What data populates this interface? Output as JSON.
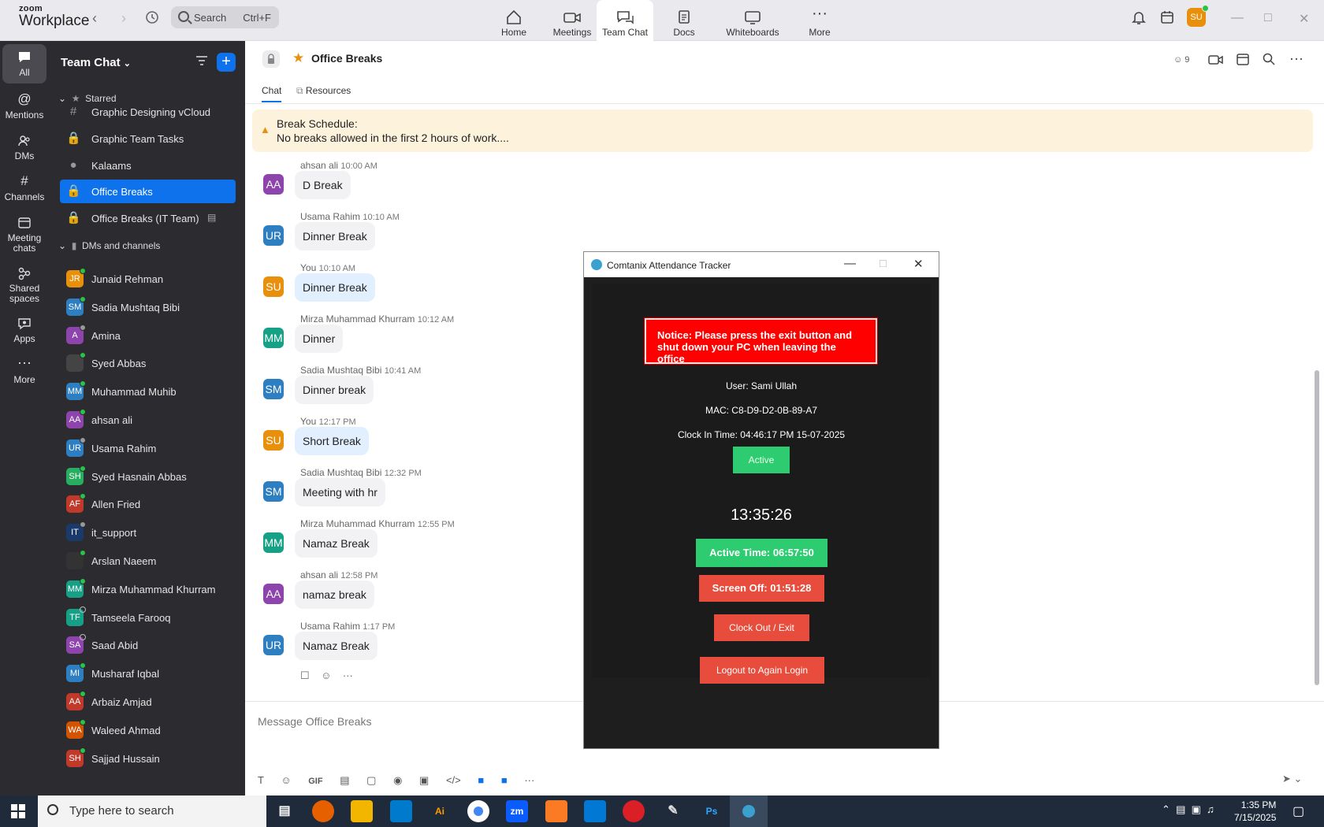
{
  "app": {
    "brand_small": "zoom",
    "brand_big": "Workplace",
    "search_label": "Search",
    "search_shortcut": "Ctrl+F",
    "nav_tabs": [
      {
        "label": "Home"
      },
      {
        "label": "Meetings"
      },
      {
        "label": "Team Chat"
      },
      {
        "label": "Docs"
      },
      {
        "label": "Whiteboards"
      },
      {
        "label": "More"
      }
    ],
    "user_initials": "SU"
  },
  "rail": [
    {
      "label": "All"
    },
    {
      "label": "Mentions"
    },
    {
      "label": "DMs"
    },
    {
      "label": "Channels"
    },
    {
      "label": "Meeting chats"
    },
    {
      "label": "Shared spaces"
    },
    {
      "label": "Apps"
    },
    {
      "label": "More"
    }
  ],
  "sidebar": {
    "title": "Team Chat",
    "starred_label": "Starred",
    "channels": [
      {
        "label": "Graphic Designing vCloud",
        "icon": "hash"
      },
      {
        "label": "Graphic Team Tasks",
        "icon": "lock"
      },
      {
        "label": "Kalaams",
        "icon": "group"
      },
      {
        "label": "Office Breaks",
        "icon": "lock"
      },
      {
        "label": "Office Breaks (IT Team)",
        "icon": "lock"
      }
    ],
    "dm_section_label": "DMs and channels",
    "dms": [
      {
        "name": "Junaid Rehman",
        "initials": "JR",
        "color": "#e8900c",
        "status": "on"
      },
      {
        "name": "Sadia Mushtaq Bibi",
        "initials": "SM",
        "color": "#2d7fc1",
        "status": "on"
      },
      {
        "name": "Amina",
        "initials": "A",
        "color": "#8e44ad",
        "status": "away"
      },
      {
        "name": "Syed Abbas",
        "initials": "",
        "color": "#444444",
        "status": "on"
      },
      {
        "name": "Muhammad Muhib",
        "initials": "MM",
        "color": "#2d7fc1",
        "status": "on"
      },
      {
        "name": "ahsan ali",
        "initials": "AA",
        "color": "#8e44ad",
        "status": "on"
      },
      {
        "name": "Usama Rahim",
        "initials": "UR",
        "color": "#2d7fc1",
        "status": "away"
      },
      {
        "name": "Syed Hasnain Abbas",
        "initials": "SH",
        "color": "#27ae60",
        "status": "on"
      },
      {
        "name": "Allen Fried",
        "initials": "AF",
        "color": "#c0392b",
        "status": "on"
      },
      {
        "name": "it_support",
        "initials": "IT",
        "color": "#1a3a6b",
        "status": "away"
      },
      {
        "name": "Arslan Naeem",
        "initials": "",
        "color": "#333333",
        "status": "on"
      },
      {
        "name": "Mirza Muhammad Khurram",
        "initials": "MM",
        "color": "#16a085",
        "status": "on"
      },
      {
        "name": "Tamseela Farooq",
        "initials": "TF",
        "color": "#16a085",
        "status": "off"
      },
      {
        "name": "Saad Abid",
        "initials": "SA",
        "color": "#8e44ad",
        "status": "off"
      },
      {
        "name": "Musharaf Iqbal",
        "initials": "MI",
        "color": "#2d7fc1",
        "status": "on"
      },
      {
        "name": "Arbaiz Amjad",
        "initials": "AA",
        "color": "#c0392b",
        "status": "on"
      },
      {
        "name": "Waleed Ahmad",
        "initials": "WA",
        "color": "#d35400",
        "status": "on"
      },
      {
        "name": "Sajjad Hussain",
        "initials": "SH",
        "color": "#c0392b",
        "status": "on"
      }
    ]
  },
  "chat": {
    "title": "Office Breaks",
    "member_count": "9",
    "tabs": [
      {
        "label": "Chat"
      },
      {
        "label": "Resources"
      }
    ],
    "pinned_line1": "Break Schedule:",
    "pinned_line2": "No breaks allowed in the first 2 hours of work....",
    "messages": [
      {
        "sender": "ahsan ali",
        "time": "10:00 AM",
        "text": "D Break",
        "initials": "AA",
        "color": "#8e44ad",
        "mine": false
      },
      {
        "sender": "Usama Rahim",
        "time": "10:10 AM",
        "text": "Dinner Break",
        "initials": "UR",
        "color": "#2d7fc1",
        "mine": false
      },
      {
        "sender": "You",
        "time": "10:10 AM",
        "text": "Dinner Break",
        "initials": "SU",
        "color": "#e8900c",
        "mine": true
      },
      {
        "sender": "Mirza Muhammad Khurram",
        "time": "10:12 AM",
        "text": "Dinner",
        "initials": "MM",
        "color": "#16a085",
        "mine": false
      },
      {
        "sender": "Sadia Mushtaq Bibi",
        "time": "10:41 AM",
        "text": "Dinner break",
        "initials": "SM",
        "color": "#2d7fc1",
        "mine": false
      },
      {
        "sender": "You",
        "time": "12:17 PM",
        "text": "Short Break",
        "initials": "SU",
        "color": "#e8900c",
        "mine": true
      },
      {
        "sender": "Sadia Mushtaq Bibi",
        "time": "12:32 PM",
        "text": "Meeting with hr",
        "initials": "SM",
        "color": "#2d7fc1",
        "mine": false
      },
      {
        "sender": "Mirza Muhammad Khurram",
        "time": "12:55 PM",
        "text": "Namaz Break",
        "initials": "MM",
        "color": "#16a085",
        "mine": false
      },
      {
        "sender": "ahsan ali",
        "time": "12:58 PM",
        "text": "namaz break",
        "initials": "AA",
        "color": "#8e44ad",
        "mine": false
      },
      {
        "sender": "Usama Rahim",
        "time": "1:17 PM",
        "text": "Namaz Break",
        "initials": "UR",
        "color": "#2d7fc1",
        "mine": false
      }
    ],
    "composer_placeholder": "Message Office Breaks",
    "composer_gif": "GIF"
  },
  "tracker": {
    "window_title": "Comtanix Attendance Tracker",
    "notice": "Notice: Please press the exit button and shut down your PC when leaving the office",
    "user_line": "User: Sami Ullah",
    "mac_line": "MAC: C8-D9-D2-0B-89-A7",
    "clock_in_line": "Clock In Time: 04:46:17 PM 15-07-2025",
    "status_label": "Active",
    "clock": "13:35:26",
    "active_time": "Active Time: 06:57:50",
    "screen_off": "Screen Off: 01:51:28",
    "clock_out_label": "Clock Out / Exit",
    "logout_label": "Logout to Again Login"
  },
  "taskbar": {
    "search_placeholder": "Type here to search",
    "apps": [
      {
        "label": "Ai",
        "color": "#300000"
      },
      {
        "label": "zm",
        "color": "#0b5cff"
      },
      {
        "label": "Ps",
        "color": "#001e36"
      }
    ],
    "time": "1:35 PM",
    "date": "7/15/2025"
  }
}
